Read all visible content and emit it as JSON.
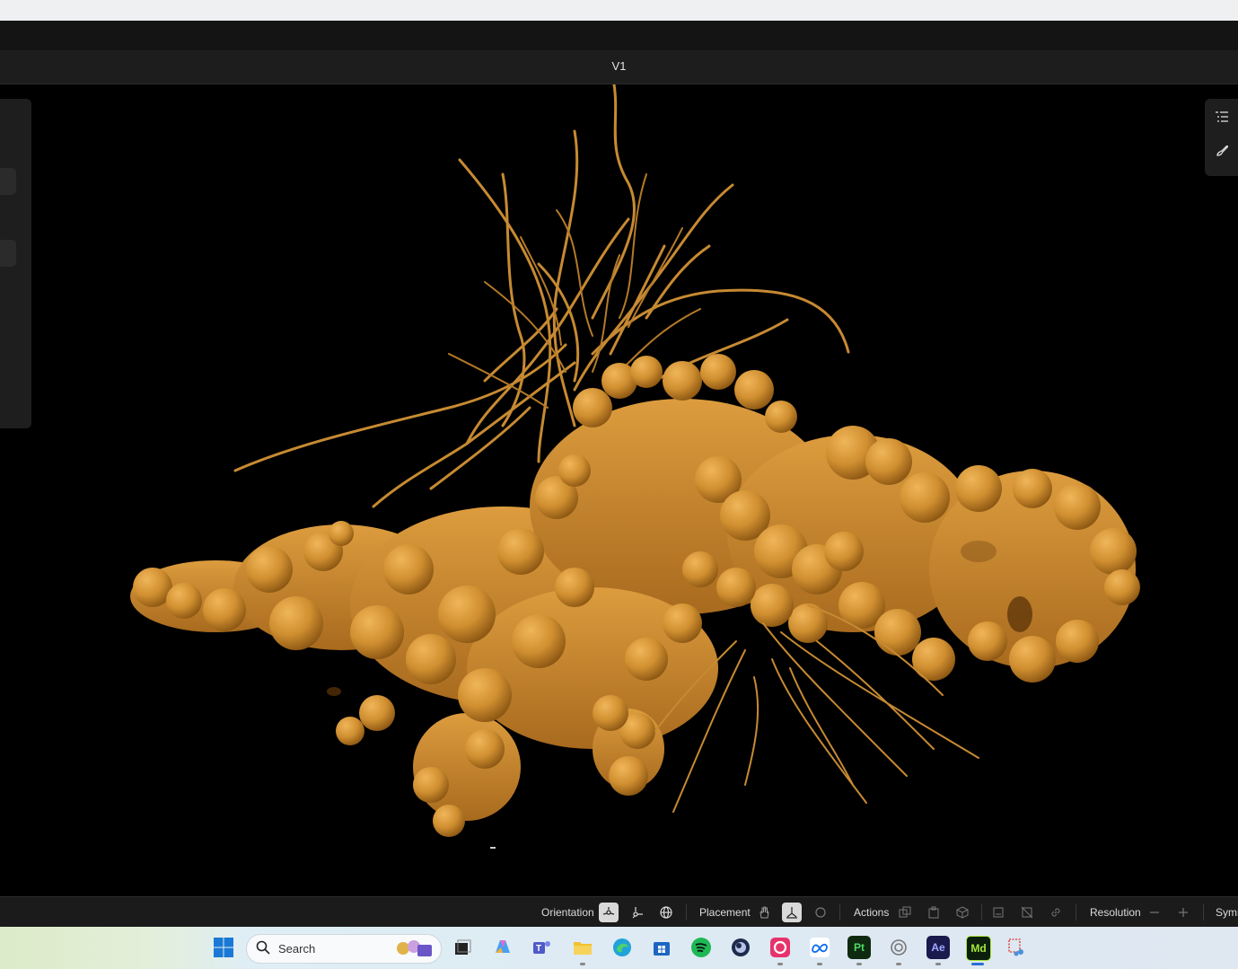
{
  "window": {
    "doc_title": "V1"
  },
  "toolbar": {
    "orientation_label": "Orientation",
    "placement_label": "Placement",
    "actions_label": "Actions",
    "resolution_label": "Resolution",
    "symmetry_label_partial": "Symr"
  },
  "taskbar": {
    "search_placeholder": "Search",
    "apps": [
      {
        "name": "start-icon"
      },
      {
        "name": "task-view-icon"
      },
      {
        "name": "copilot-icon"
      },
      {
        "name": "teams-icon"
      },
      {
        "name": "file-explorer-icon"
      },
      {
        "name": "edge-icon"
      },
      {
        "name": "store-icon"
      },
      {
        "name": "spotify-icon"
      },
      {
        "name": "cinema4d-icon"
      },
      {
        "name": "creative-cloud-icon"
      },
      {
        "name": "meta-icon"
      },
      {
        "name": "substance-painter-icon",
        "label": "Pt"
      },
      {
        "name": "gaming-icon"
      },
      {
        "name": "after-effects-icon",
        "label": "Ae"
      },
      {
        "name": "modeler-icon",
        "label": "Md"
      },
      {
        "name": "snipping-tool-icon"
      }
    ]
  },
  "colors": {
    "model": "#c98a2a",
    "model_light": "#e3a54a",
    "model_dark": "#8a5512",
    "background": "#000000",
    "panel": "#1e1e1e"
  }
}
